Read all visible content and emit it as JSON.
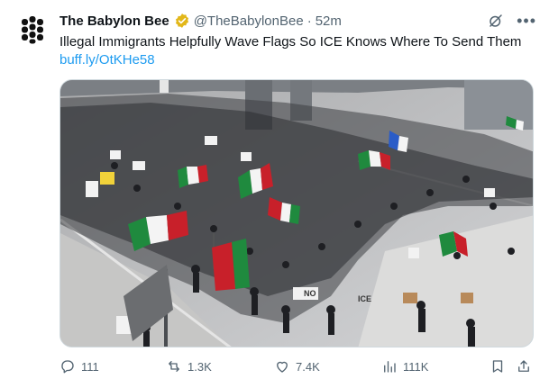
{
  "tweet": {
    "author_name": "The Babylon Bee",
    "handle": "@TheBabylonBee",
    "separator": "·",
    "time": "52m",
    "text": "Illegal Immigrants Helpfully Wave Flags So ICE Knows Where To Send Them",
    "link": "buff.ly/OtKHe58"
  },
  "media": {
    "sign_texts": [
      "ICE",
      "NO"
    ]
  },
  "actions": {
    "replies": "111",
    "reposts": "1.3K",
    "likes": "7.4K",
    "views": "111K"
  },
  "colors": {
    "link": "#1d9bf0",
    "secondary_text": "#536471",
    "verified": "#e2b719",
    "flag_green": "#1f8a3e",
    "flag_red": "#c8202a"
  },
  "icons": [
    "bee-logo-icon",
    "verified-badge-icon",
    "grok-icon",
    "more-icon",
    "reply-icon",
    "repost-icon",
    "like-icon",
    "views-icon",
    "bookmark-icon",
    "share-icon"
  ]
}
